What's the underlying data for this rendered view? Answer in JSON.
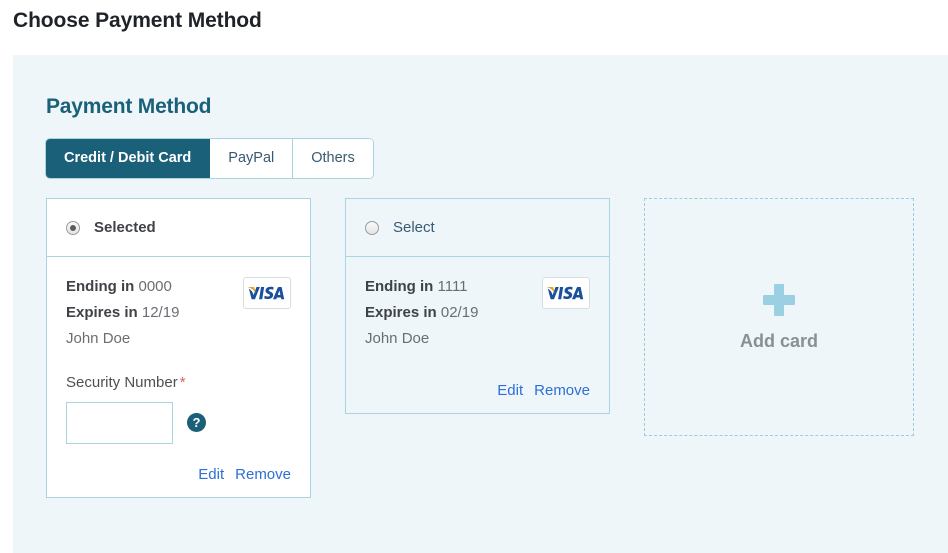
{
  "page": {
    "title": "Choose Payment Method"
  },
  "panel": {
    "heading": "Payment Method",
    "accent_color": "#1a6079",
    "background_color": "#eef6f9",
    "border_color": "#a9d4e2",
    "link_color": "#2d6fd6",
    "required_color": "#e06256"
  },
  "tabs": [
    {
      "label": "Credit / Debit Card",
      "active": true
    },
    {
      "label": "PayPal",
      "active": false
    },
    {
      "label": "Others",
      "active": false
    }
  ],
  "cards": [
    {
      "state_label": "Selected",
      "selected": true,
      "ending_label": "Ending in",
      "ending_value": "0000",
      "expires_label": "Expires in",
      "expires_value": "12/19",
      "holder": "John Doe",
      "brand": "VISA",
      "security": {
        "label": "Security Number",
        "required_mark": "*",
        "value": "",
        "placeholder": "",
        "help_icon": "question-mark-icon"
      },
      "edit_label": "Edit",
      "remove_label": "Remove"
    },
    {
      "state_label": "Select",
      "selected": false,
      "ending_label": "Ending in",
      "ending_value": "1111",
      "expires_label": "Expires in",
      "expires_value": "02/19",
      "holder": "John Doe",
      "brand": "VISA",
      "edit_label": "Edit",
      "remove_label": "Remove"
    }
  ],
  "add_card": {
    "label": "Add card",
    "icon": "plus-icon"
  }
}
